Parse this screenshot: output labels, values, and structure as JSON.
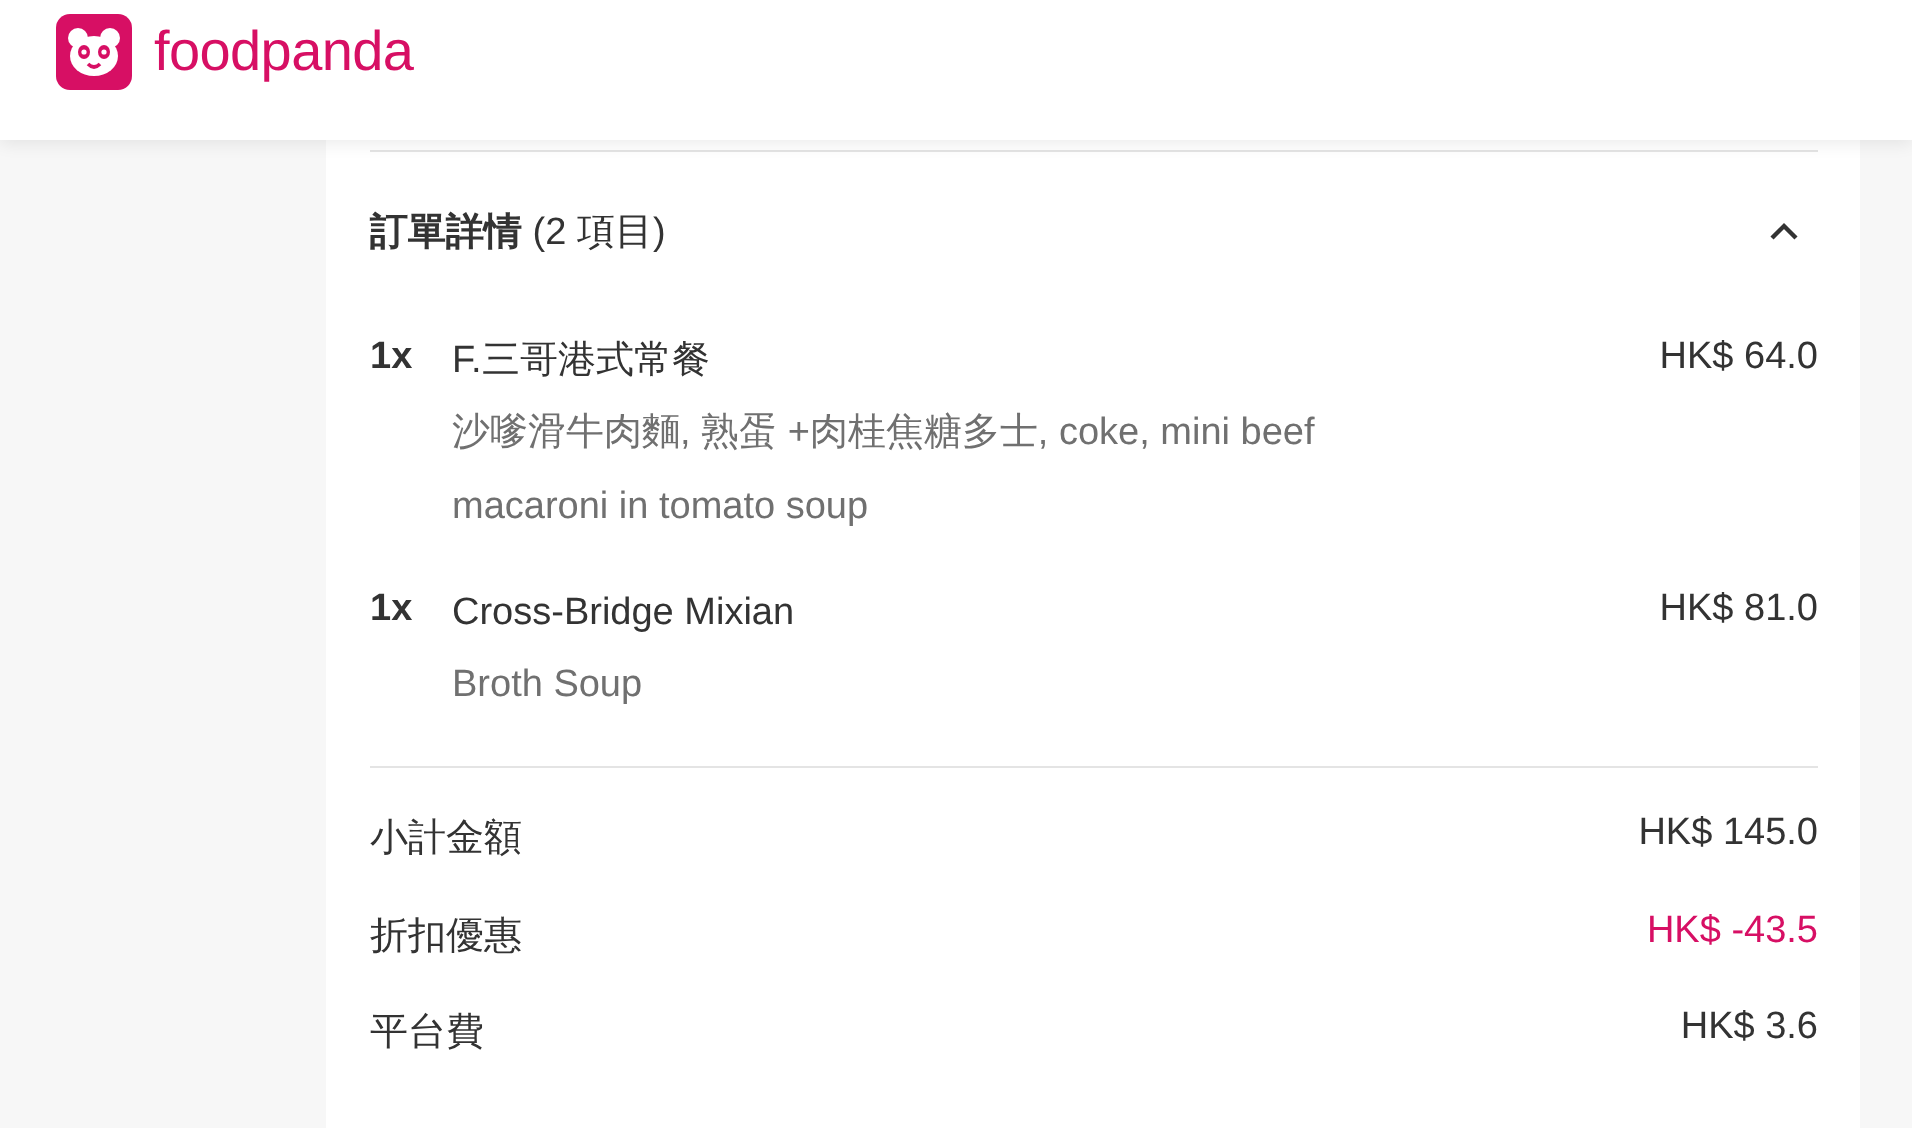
{
  "header": {
    "logo_text": "foodpanda"
  },
  "order_details": {
    "title": "**訂單詳情** (2 項目)",
    "expanded": true,
    "items": [
      {
        "quantity": "1x",
        "name": "F.三哥港式常餐",
        "price": "HK$ 64.0",
        "description": "沙嗲滑牛肉麵, 熟蛋 +肉桂焦糖多士, coke, mini beef macaroni in tomato soup"
      },
      {
        "quantity": "1x",
        "name": "Cross-Bridge Mixian",
        "price": "HK$ 81.0",
        "description": "Broth Soup"
      }
    ],
    "summary": [
      {
        "kind": "normal",
        "label": "小計金額",
        "value": "HK$ 145.0"
      },
      {
        "kind": "discount",
        "label": "折扣優惠",
        "value": "HK$ -43.5"
      },
      {
        "kind": "normal",
        "label": "平台費",
        "value": "HK$ 3.6"
      }
    ]
  }
}
